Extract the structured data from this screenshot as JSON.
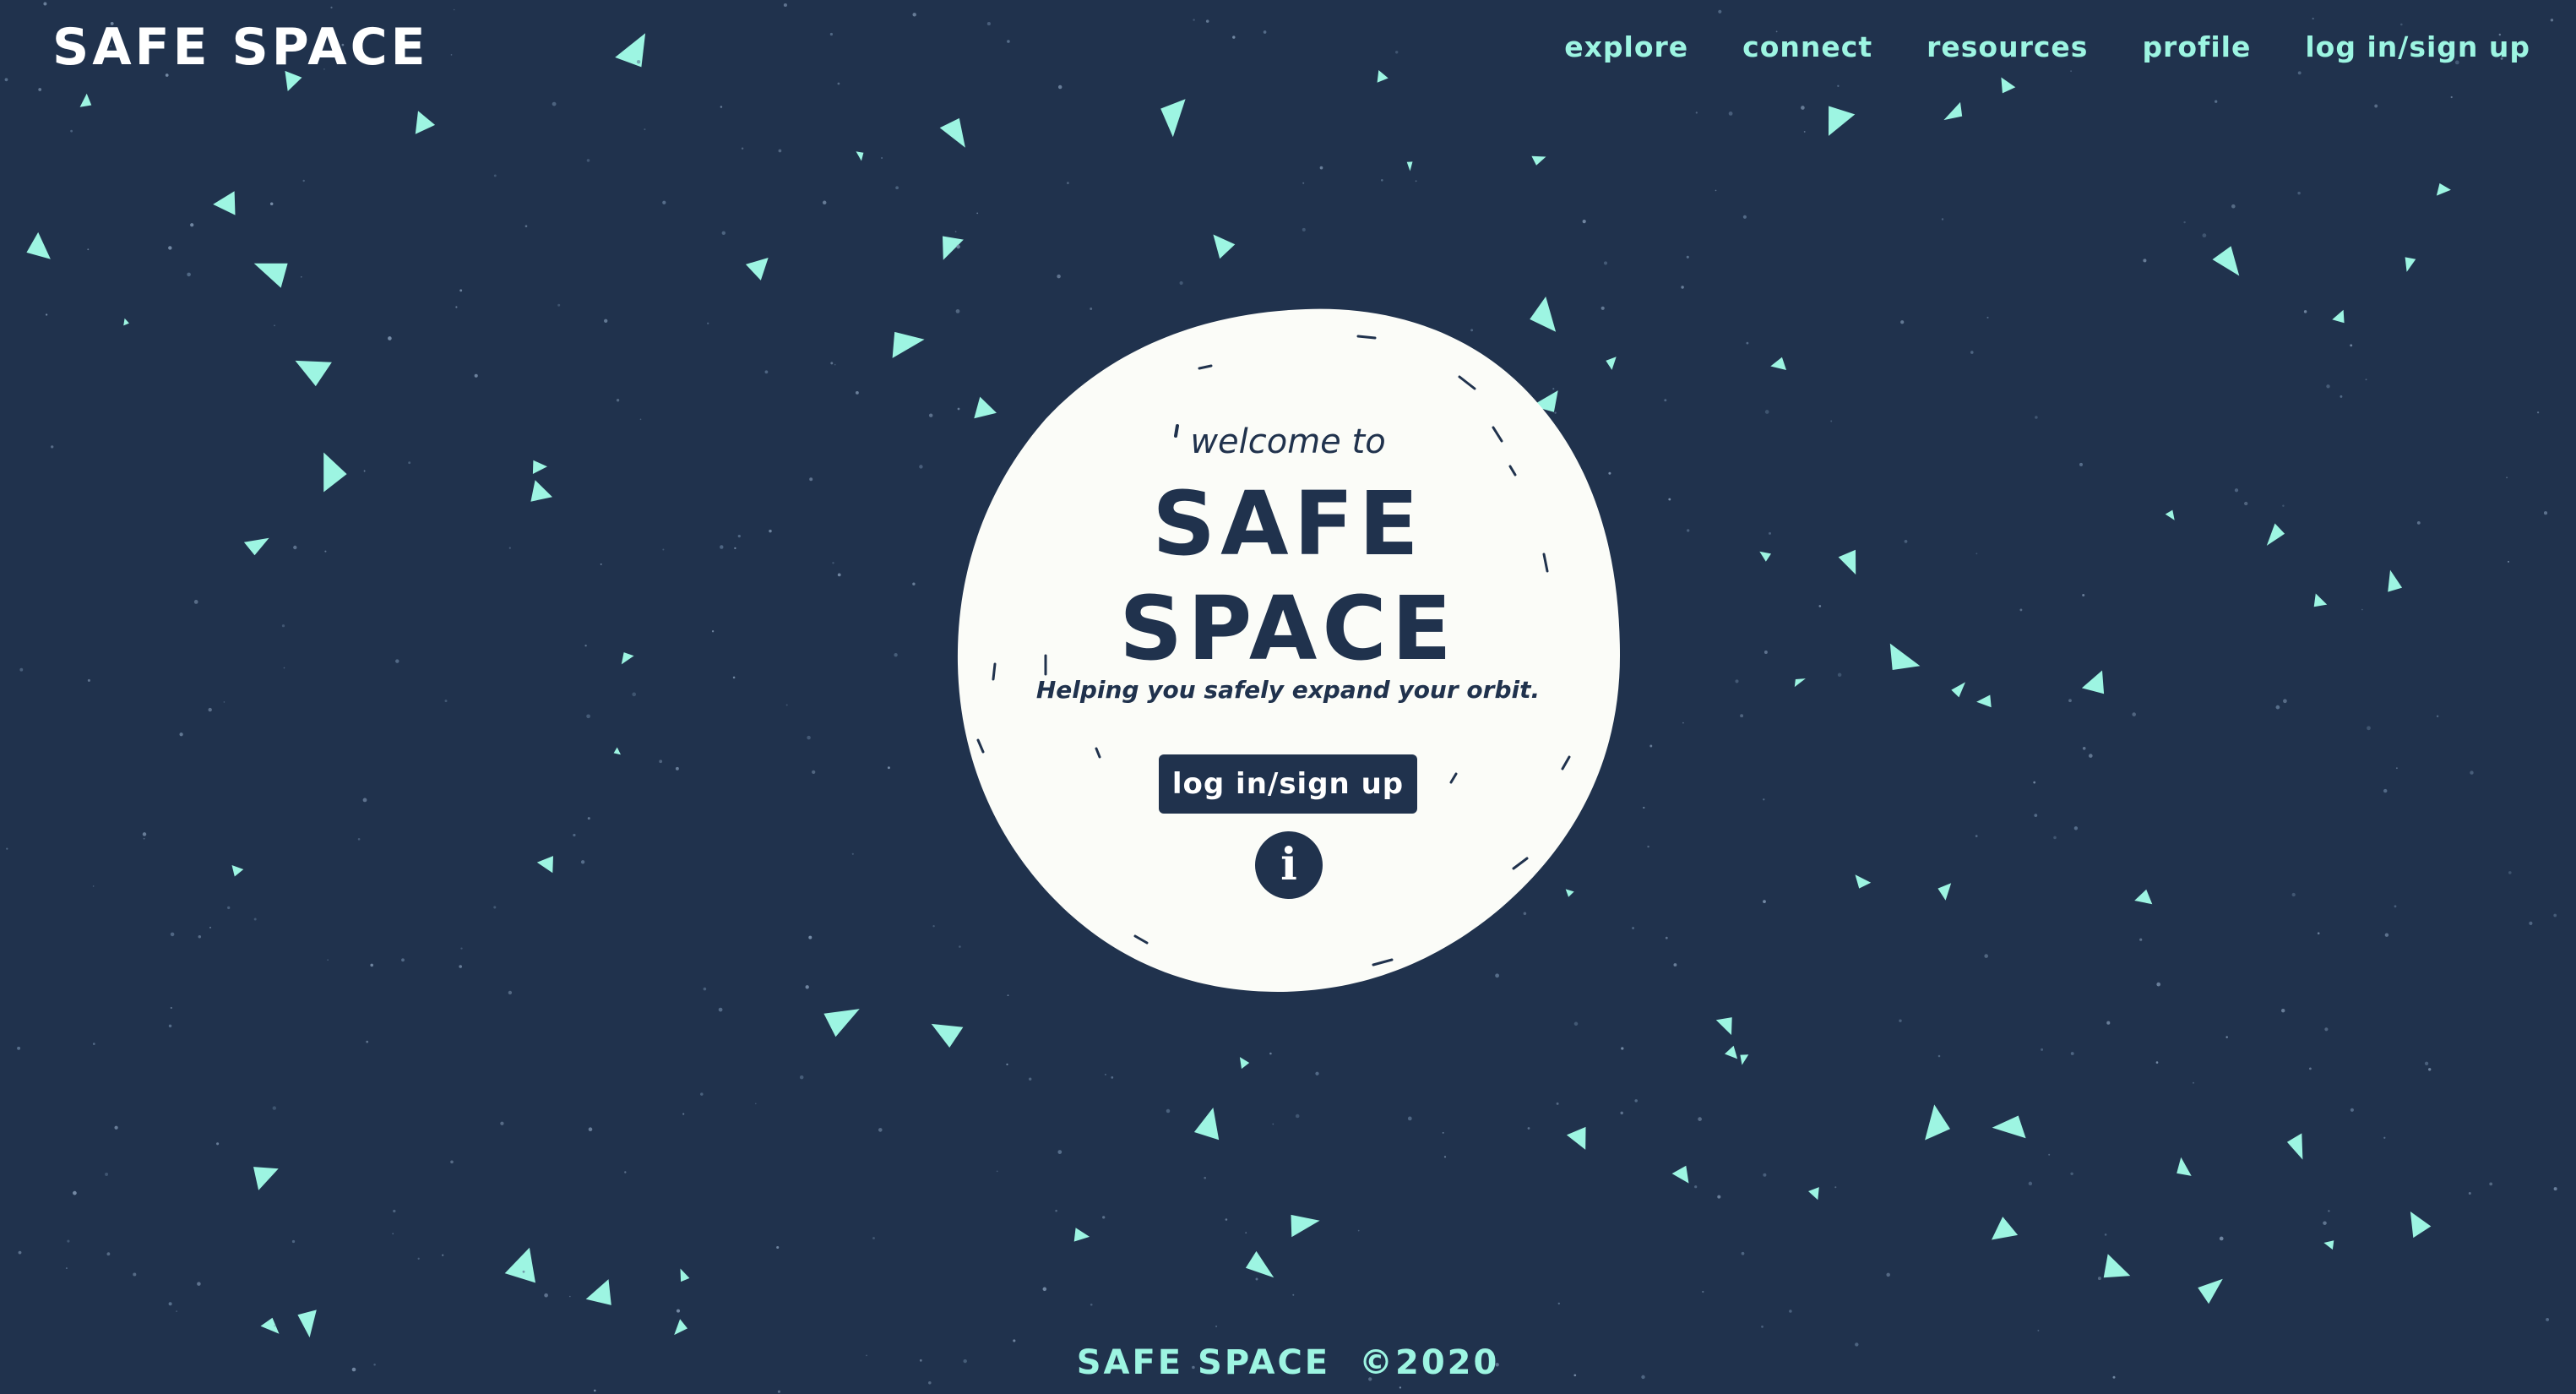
{
  "header": {
    "brand": "SAFE SPACE"
  },
  "nav": {
    "items": [
      {
        "label": "explore"
      },
      {
        "label": "connect"
      },
      {
        "label": "resources"
      },
      {
        "label": "profile"
      },
      {
        "label": "log in/sign up"
      }
    ]
  },
  "hero": {
    "welcome": "welcome to",
    "title_line1": "SAFE",
    "title_line2": "SPACE",
    "tagline": "Helping you safely expand your orbit.",
    "cta_label": "log in/sign up",
    "info_label": "i"
  },
  "footer": {
    "brand": "SAFE SPACE",
    "copyright": "©2020"
  },
  "colors": {
    "background": "#20324d",
    "accent": "#9df5e2",
    "planet": "#fbfcf8",
    "text_dark": "#20324d",
    "text_light": "#ffffff"
  },
  "icons": {
    "info": "info-icon"
  }
}
